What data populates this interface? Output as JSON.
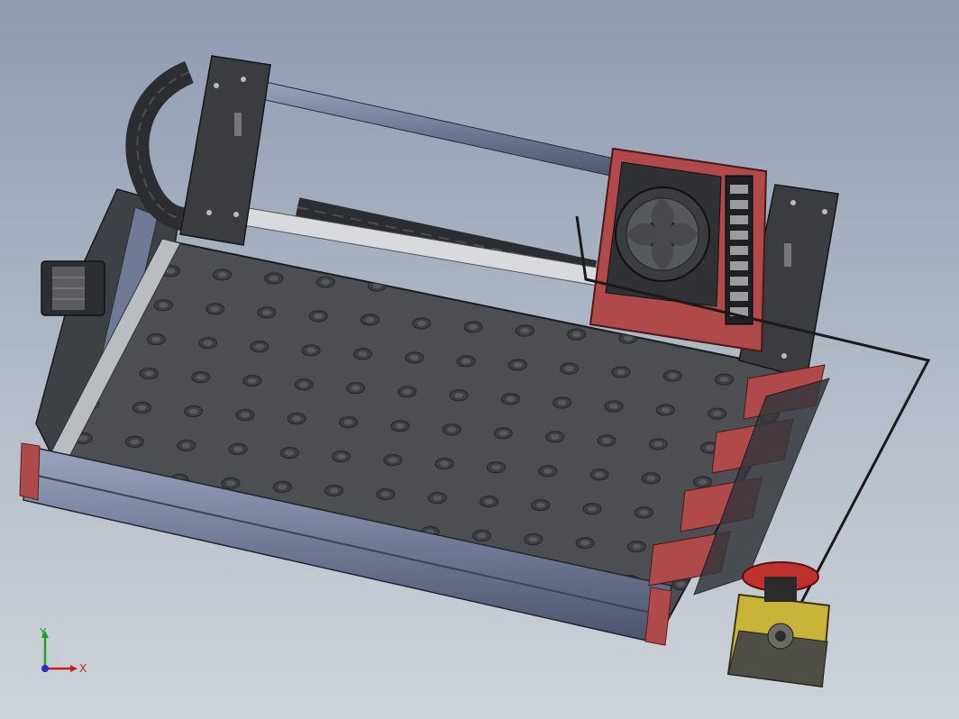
{
  "viewport": {
    "background_top": "#8e9cb1",
    "background_bottom": "#cdd3da"
  },
  "model": {
    "components": [
      "machine-bed",
      "gantry",
      "spindle-motor-box",
      "terminal-strip",
      "cooling-fan",
      "stepper-motor",
      "cable-chain",
      "tool-holders",
      "emergency-stop-button"
    ],
    "colors": {
      "frame": "#3a3d42",
      "extrusion": "#7a86a6",
      "bracket_red": "#b04a4a",
      "estop_yellow": "#c9b43a",
      "estop_red": "#c0302c"
    }
  },
  "triad": {
    "x_label": "X",
    "y_label": "Y",
    "x_color": "#c42020",
    "y_color": "#20a020",
    "z_color": "#2030c0"
  }
}
